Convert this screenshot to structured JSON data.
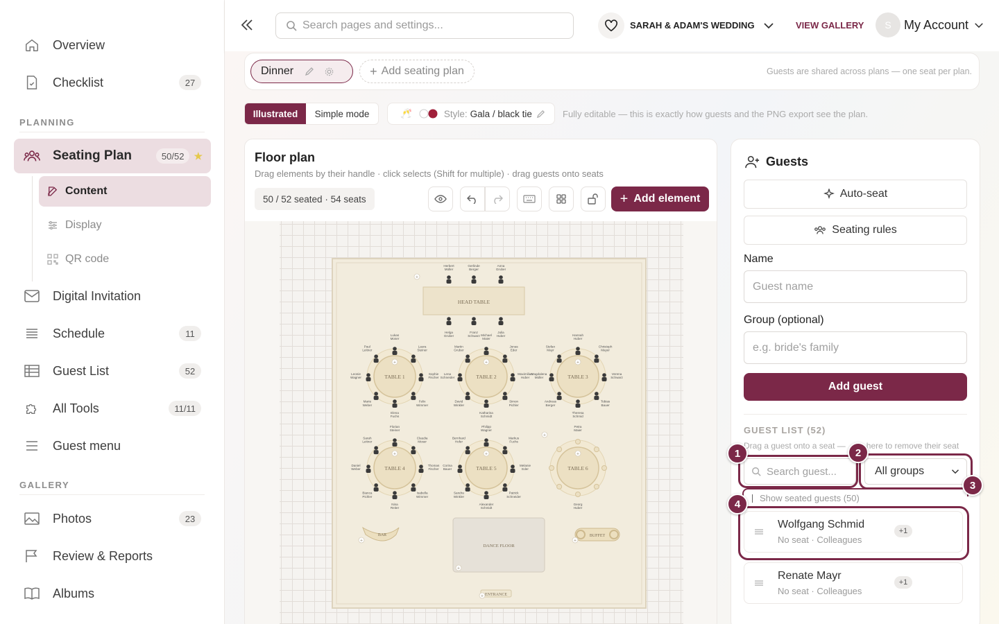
{
  "sidebar": {
    "overview": "Overview",
    "checklist": {
      "label": "Checklist",
      "count": "27"
    },
    "planning_title": "PLANNING",
    "seating": {
      "label": "Seating Plan",
      "count": "50/52"
    },
    "sub": {
      "content": "Content",
      "display": "Display",
      "qr": "QR code"
    },
    "invitation": "Digital Invitation",
    "schedule": {
      "label": "Schedule",
      "count": "11"
    },
    "guestlist": {
      "label": "Guest List",
      "count": "52"
    },
    "alltools": {
      "label": "All Tools",
      "count": "11/11"
    },
    "guestmenu": "Guest menu",
    "gallery_title": "GALLERY",
    "photos": {
      "label": "Photos",
      "count": "23"
    },
    "review": "Review & Reports",
    "albums": "Albums"
  },
  "header": {
    "search_placeholder": "Search pages and settings...",
    "event": "SARAH & ADAM'S WEDDING",
    "view_gallery": "VIEW GALLERY",
    "avatar_initial": "S",
    "account": "My Account"
  },
  "plans": {
    "active": "Dinner",
    "add": "Add seating plan",
    "note": "Guests are shared across plans — one seat per plan."
  },
  "mode": {
    "illustrated": "Illustrated",
    "simple": "Simple mode",
    "style_label": "Style:",
    "style_value": "Gala / black tie",
    "note": "Fully editable — this is exactly how guests and the PNG export see the plan."
  },
  "floor": {
    "title": "Floor plan",
    "subtitle": "Drag elements by their handle · click selects (Shift for multiple) · drag guests onto seats",
    "stats": "50 / 52 seated · 54 seats",
    "add_element": "Add element",
    "head_table": "HEAD TABLE",
    "tables": [
      "TABLE 1",
      "TABLE 2",
      "TABLE 3",
      "TABLE 4",
      "TABLE 5",
      "TABLE 6"
    ],
    "bar": "BAR",
    "buffet": "BUFFET",
    "dance": "DANCE FLOOR",
    "entrance": "ENTRANCE",
    "head_guests": [
      "Herbert Müller",
      "Gerlinde Berger",
      "Anna Gruber"
    ],
    "head_bottom": [
      "Helga Gruber",
      "Franz Schwarz",
      "Julia Huber"
    ],
    "names": [
      "Lukas Moser",
      "Laura Steiner",
      "Sophie Fischer",
      "Felix Wimmer",
      "Elena Fuchs",
      "Marie Weber",
      "Leonie Wagner",
      "Paul Leitner",
      "Michael Maier",
      "Jonas Eder",
      "Maximilian Huber",
      "Simon Pichler",
      "Katharina Schmidt",
      "David Winkler",
      "Lena Schneider",
      "Martin Gruber",
      "Hannah Huber",
      "Christoph Mayer",
      "Verena Schwarz",
      "Tobias Bauer",
      "Theresa Schmid",
      "Andreas Berger",
      "Magdalena Müller",
      "Stefan Mayr",
      "Florian Steiner",
      "Claudia Moser",
      "Thomas Fischer",
      "Isabella Wimmer",
      "Nina Reiter",
      "Bianca Pichler",
      "Daniel Weber",
      "Sarah Leitner",
      "Philipp Wagner",
      "Markus Fuchs",
      "Melanie Eder",
      "Patrick Schneider",
      "Alexander Schmidt",
      "Sandra Winkler",
      "Corina Bauer",
      "Bernhard Hofer",
      "Petra Maier",
      "Georg Huber",
      "Elisabeth Mayer",
      "Sophie Brunner"
    ]
  },
  "guests": {
    "title": "Guests",
    "auto_seat": "Auto-seat",
    "rules": "Seating rules",
    "name_label": "Name",
    "name_ph": "Guest name",
    "group_label": "Group (optional)",
    "group_ph": "e.g. bride's family",
    "add": "Add guest",
    "list_title": "GUEST LIST (52)",
    "hint_a": "Drag a guest onto a seat —",
    "hint_b": "here to remove their seat",
    "search_ph": "Search guest...",
    "groups": "All groups",
    "show_seated": "Show seated guests (50)",
    "items": [
      {
        "name": "Wolfgang Schmid",
        "meta": "No seat · Colleagues",
        "plus": "+1"
      },
      {
        "name": "Renate Mayr",
        "meta": "No seat · Colleagues",
        "plus": "+1"
      }
    ],
    "markers": [
      "1",
      "2",
      "3",
      "4"
    ]
  },
  "colors": {
    "accent": "#7b2848",
    "accent_light": "#ecdde1",
    "gold": "#c9b27c"
  }
}
